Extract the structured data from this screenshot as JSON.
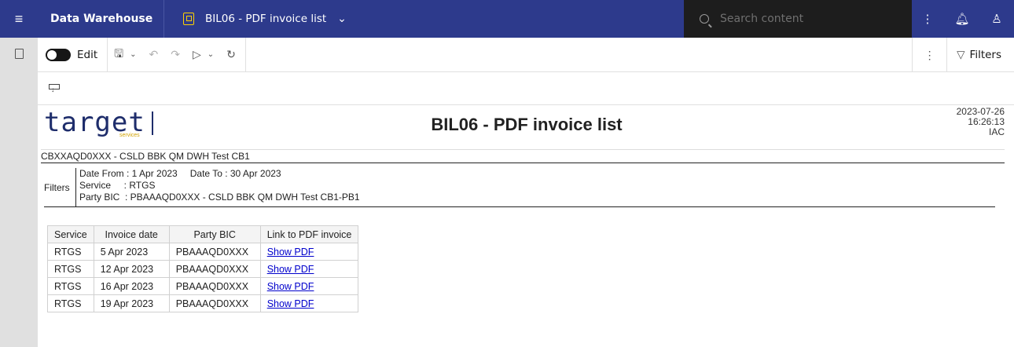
{
  "header": {
    "app_title": "Data Warehouse",
    "report_tab": "BIL06 - PDF invoice list",
    "search_placeholder": "Search content"
  },
  "toolbar": {
    "edit_label": "Edit",
    "filters_label": "Filters"
  },
  "report": {
    "logo_text": "target",
    "logo_sub": "services",
    "title": "BIL06 - PDF invoice list",
    "date": "2023-07-26",
    "time": "16:26:13",
    "env": "IAC",
    "participant": "CBXXAQD0XXX - CSLD BBK QM DWH Test CB1",
    "filters": {
      "label": "Filters",
      "date_from": "Date From : 1 Apr 2023",
      "date_to": "Date To : 30 Apr 2023",
      "service": "Service     : RTGS",
      "party_bic": "Party BIC  : PBAAAQD0XXX - CSLD BBK QM DWH Test CB1-PB1"
    },
    "table": {
      "columns": [
        "Service",
        "Invoice date",
        "Party BIC",
        "Link to PDF invoice"
      ],
      "rows": [
        {
          "service": "RTGS",
          "date": "5 Apr 2023",
          "bic": "PBAAAQD0XXX",
          "link": "Show PDF"
        },
        {
          "service": "RTGS",
          "date": "12 Apr 2023",
          "bic": "PBAAAQD0XXX",
          "link": "Show PDF"
        },
        {
          "service": "RTGS",
          "date": "16 Apr 2023",
          "bic": "PBAAAQD0XXX",
          "link": "Show PDF"
        },
        {
          "service": "RTGS",
          "date": "19 Apr 2023",
          "bic": "PBAAAQD0XXX",
          "link": "Show PDF"
        }
      ]
    }
  },
  "colors": {
    "topbar": "#2d3a8c",
    "search_bg": "#1d1d1d",
    "accent_yellow": "#ffd200",
    "logo_blue": "#1e2d6b",
    "link": "#0000cc"
  }
}
